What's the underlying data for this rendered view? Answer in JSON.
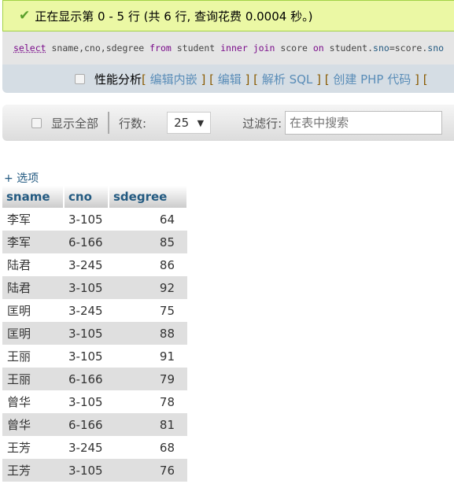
{
  "success": {
    "message": "正在显示第 0 - 5 行 (共 6 行, 查询花费 0.0004 秒。)",
    "icon": "check-icon"
  },
  "sql": {
    "tokens": [
      {
        "t": "select",
        "c": "kw u"
      },
      {
        "t": " sname,cno,sdegree ",
        "c": ""
      },
      {
        "t": "from",
        "c": "kw"
      },
      {
        "t": " student ",
        "c": ""
      },
      {
        "t": "inner",
        "c": "kw"
      },
      {
        "t": " ",
        "c": ""
      },
      {
        "t": "join",
        "c": "kw"
      },
      {
        "t": " score ",
        "c": ""
      },
      {
        "t": "on",
        "c": "kw"
      },
      {
        "t": " student.",
        "c": ""
      },
      {
        "t": "sno",
        "c": "col"
      },
      {
        "t": "=score.",
        "c": ""
      },
      {
        "t": "sno",
        "c": "col"
      }
    ]
  },
  "tools": {
    "profiling": "性能分析",
    "links": [
      "编辑内嵌",
      "编辑",
      "解析 SQL",
      "创建 PHP 代码"
    ]
  },
  "nav": {
    "show_all": "显示全部",
    "rows_label": "行数:",
    "rows_value": "25",
    "filter_label": "过滤行:",
    "search_placeholder": "在表中搜索"
  },
  "options_label": "+ 选项",
  "table": {
    "columns": [
      "sname",
      "cno",
      "sdegree"
    ],
    "rows": [
      [
        "李军",
        "3-105",
        "64"
      ],
      [
        "李军",
        "6-166",
        "85"
      ],
      [
        "陆君",
        "3-245",
        "86"
      ],
      [
        "陆君",
        "3-105",
        "92"
      ],
      [
        "匡明",
        "3-245",
        "75"
      ],
      [
        "匡明",
        "3-105",
        "88"
      ],
      [
        "王丽",
        "3-105",
        "91"
      ],
      [
        "王丽",
        "6-166",
        "79"
      ],
      [
        "曾华",
        "3-105",
        "78"
      ],
      [
        "曾华",
        "6-166",
        "81"
      ],
      [
        "王芳",
        "3-245",
        "68"
      ],
      [
        "王芳",
        "3-105",
        "76"
      ]
    ]
  }
}
